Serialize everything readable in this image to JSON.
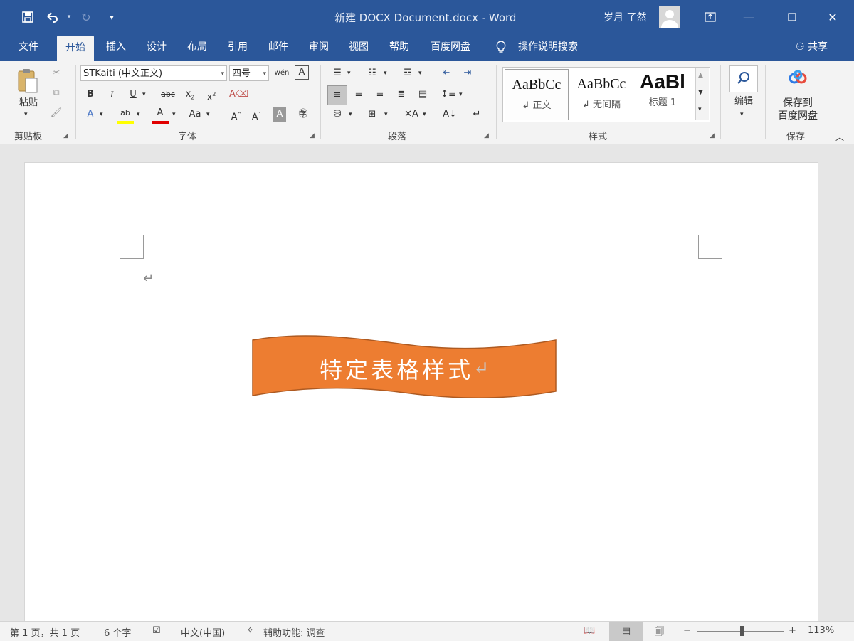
{
  "window": {
    "title": "新建 DOCX Document.docx  -  Word",
    "user": "岁月 了然",
    "accent": "#2b579a"
  },
  "tabs": [
    {
      "label": "文件"
    },
    {
      "label": "开始",
      "active": true
    },
    {
      "label": "插入"
    },
    {
      "label": "设计"
    },
    {
      "label": "布局"
    },
    {
      "label": "引用"
    },
    {
      "label": "邮件"
    },
    {
      "label": "审阅"
    },
    {
      "label": "视图"
    },
    {
      "label": "帮助"
    },
    {
      "label": "百度网盘"
    }
  ],
  "tell_me": "操作说明搜索",
  "share": "共享",
  "ribbon": {
    "clipboard": {
      "paste": "粘贴",
      "label": "剪贴板"
    },
    "font": {
      "name": "STKaiti (中文正文)",
      "size": "四号",
      "label": "字体"
    },
    "paragraph": {
      "label": "段落"
    },
    "styles": {
      "label": "样式",
      "items": [
        {
          "sample": "AaBbCc",
          "name": "↲ 正文"
        },
        {
          "sample": "AaBbCc",
          "name": "↲ 无间隔"
        },
        {
          "sample": "AaBl",
          "name": "标题 1"
        }
      ]
    },
    "editing": {
      "label": "编辑"
    },
    "save": {
      "button": "保存到\n百度网盘",
      "line1": "保存到",
      "line2": "百度网盘",
      "label": "保存"
    }
  },
  "document": {
    "banner_text": "特定表格样式",
    "banner_color": "#ed7d31",
    "pilcrow": "↵"
  },
  "status": {
    "page": "第 1 页，共 1 页",
    "words": "6 个字",
    "language": "中文(中国)",
    "accessibility": "辅助功能: 调查",
    "zoom": "113%"
  }
}
